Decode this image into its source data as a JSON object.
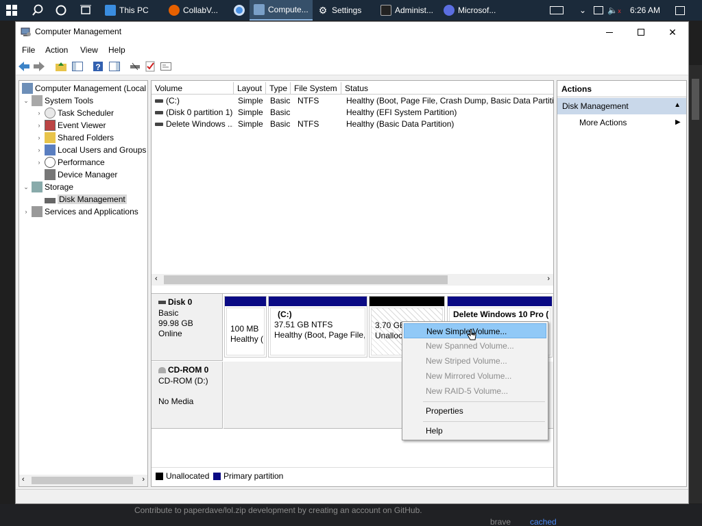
{
  "taskbar": {
    "tasks": [
      "This PC",
      "CollabV...",
      "Compute...",
      "Settings",
      "Administ...",
      "Microsof..."
    ],
    "clock": "6:26 AM"
  },
  "background": {
    "github_message": "Contribute to paperdave/lol.zip development by creating an account on GitHub.",
    "brave": "brave",
    "cached": "cached"
  },
  "window": {
    "title": "Computer Management",
    "menu": [
      "File",
      "Action",
      "View",
      "Help"
    ]
  },
  "tree": {
    "root": "Computer Management (Local",
    "system_tools": "System Tools",
    "task_scheduler": "Task Scheduler",
    "event_viewer": "Event Viewer",
    "shared_folders": "Shared Folders",
    "local_users": "Local Users and Groups",
    "performance": "Performance",
    "device_manager": "Device Manager",
    "storage": "Storage",
    "disk_management": "Disk Management",
    "services": "Services and Applications"
  },
  "volumes": {
    "columns": [
      "Volume",
      "Layout",
      "Type",
      "File System",
      "Status"
    ],
    "rows": [
      {
        "volume": "(C:)",
        "layout": "Simple",
        "type": "Basic",
        "fs": "NTFS",
        "status": "Healthy (Boot, Page File, Crash Dump, Basic Data Partition"
      },
      {
        "volume": "(Disk 0 partition 1)",
        "layout": "Simple",
        "type": "Basic",
        "fs": "",
        "status": "Healthy (EFI System Partition)"
      },
      {
        "volume": "Delete Windows ...",
        "layout": "Simple",
        "type": "Basic",
        "fs": "NTFS",
        "status": "Healthy (Basic Data Partition)"
      }
    ]
  },
  "disks": {
    "disk0": {
      "name": "Disk 0",
      "type": "Basic",
      "size": "99.98 GB",
      "state": "Online"
    },
    "cdrom0": {
      "name": "CD-ROM 0",
      "drive": "CD-ROM (D:)",
      "media": "No Media"
    },
    "partitions": {
      "p1": {
        "size": "100 MB",
        "status": "Healthy ("
      },
      "p2": {
        "name": "(C:)",
        "size": "37.51 GB NTFS",
        "status": "Healthy (Boot, Page File,"
      },
      "p3": {
        "size": "3.70 GB",
        "status": "Unalloca"
      },
      "p4": {
        "name": "Delete Windows 10 Pro ("
      }
    }
  },
  "legend": {
    "unallocated": "Unallocated",
    "primary": "Primary partition"
  },
  "actions": {
    "title": "Actions",
    "group": "Disk Management",
    "more": "More Actions"
  },
  "context_menu": {
    "items": [
      {
        "label": "New Simple Volume...",
        "state": "highlighted"
      },
      {
        "label": "New Spanned Volume...",
        "state": "disabled"
      },
      {
        "label": "New Striped Volume...",
        "state": "disabled"
      },
      {
        "label": "New Mirrored Volume...",
        "state": "disabled"
      },
      {
        "label": "New RAID-5 Volume...",
        "state": "disabled"
      },
      {
        "label": "Properties",
        "state": "enabled"
      },
      {
        "label": "Help",
        "state": "enabled"
      }
    ]
  },
  "colors": {
    "primary_partition": "#0a0a84",
    "unallocated": "#000000",
    "menu_highlight": "#91c9f7"
  }
}
